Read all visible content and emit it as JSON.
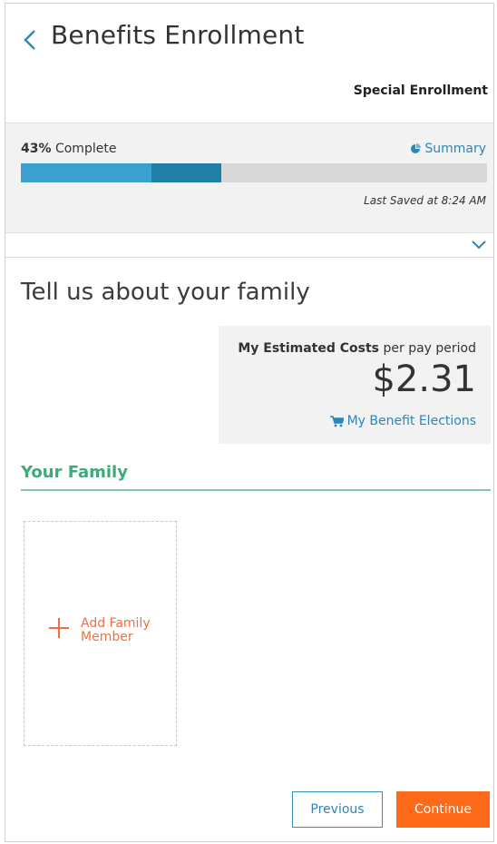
{
  "header": {
    "title": "Benefits Enrollment",
    "mode": "Special Enrollment"
  },
  "progress": {
    "percent_label": "43%",
    "complete_label": "Complete",
    "percent_value": 43,
    "summary_label": "Summary",
    "last_saved": "Last Saved at 8:24 AM"
  },
  "main": {
    "section_title": "Tell us about your family",
    "costs": {
      "caption_bold": "My Estimated Costs",
      "caption_rest": "per pay period",
      "amount": "$2.31",
      "elections_link": "My Benefit Elections"
    },
    "family": {
      "heading": "Your Family",
      "add_member_label": "Add Family Member"
    }
  },
  "footer": {
    "previous_label": "Previous",
    "continue_label": "Continue"
  },
  "colors": {
    "link": "#2e86b8",
    "progress_fill": "#3aa0d0",
    "progress_fill_dark": "#1f7fa7",
    "family_green": "#3daa78",
    "accent_orange": "#ff6a1a"
  },
  "icons": {
    "back": "chevron-left-icon",
    "summary": "chart-icon",
    "expand": "chevron-down-icon",
    "cart": "cart-icon",
    "add": "plus-icon"
  }
}
